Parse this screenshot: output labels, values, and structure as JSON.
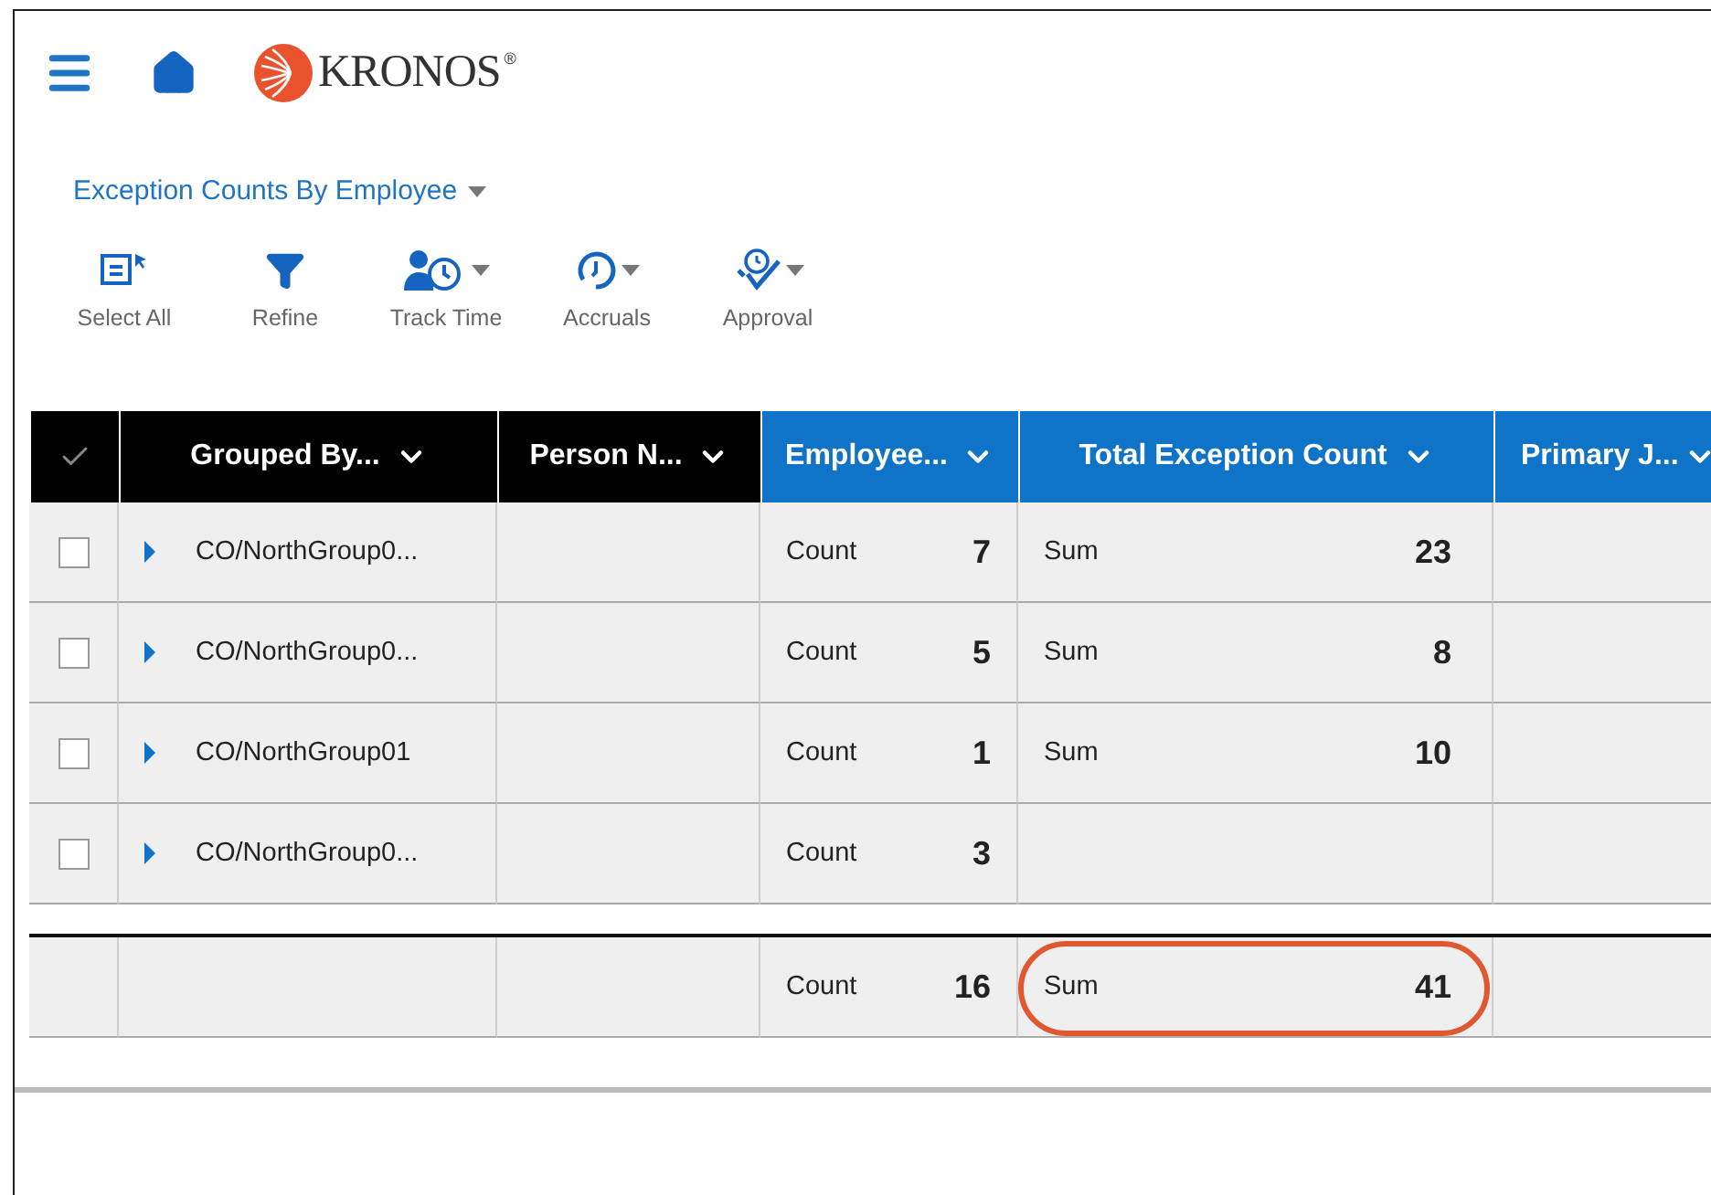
{
  "brand": {
    "name": "KRONOS",
    "mark": "®"
  },
  "report": {
    "title": "Exception Counts By Employee"
  },
  "toolbar": [
    {
      "kind": "select",
      "label": "Select All",
      "menu": false
    },
    {
      "kind": "refine",
      "label": "Refine",
      "menu": false
    },
    {
      "kind": "track",
      "label": "Track Time",
      "menu": true
    },
    {
      "kind": "accruals",
      "label": "Accruals",
      "menu": true
    },
    {
      "kind": "approval",
      "label": "Approval",
      "menu": true
    }
  ],
  "table": {
    "columns": [
      {
        "label": "Grouped By...",
        "selected": false
      },
      {
        "label": "Person N...",
        "selected": false
      },
      {
        "label": "Employee...",
        "selected": true
      },
      {
        "label": "Total Exception Count",
        "selected": true
      },
      {
        "label": "Primary J...",
        "selected": true
      }
    ],
    "rows": [
      {
        "checked": false,
        "expanded": false,
        "group": "CO/NorthGroup0...",
        "count_label": "Count",
        "count": "7",
        "sum_label": "Sum",
        "sum": "23"
      },
      {
        "checked": false,
        "expanded": false,
        "group": "CO/NorthGroup0...",
        "count_label": "Count",
        "count": "5",
        "sum_label": "Sum",
        "sum": "8"
      },
      {
        "checked": false,
        "expanded": false,
        "group": "CO/NorthGroup01",
        "count_label": "Count",
        "count": "1",
        "sum_label": "Sum",
        "sum": "10"
      },
      {
        "checked": false,
        "expanded": false,
        "group": "CO/NorthGroup0...",
        "count_label": "Count",
        "count": "3"
      }
    ],
    "totals": {
      "count_label": "Count",
      "count": "16",
      "sum_label": "Sum",
      "sum": "41",
      "highlighted": true
    }
  }
}
